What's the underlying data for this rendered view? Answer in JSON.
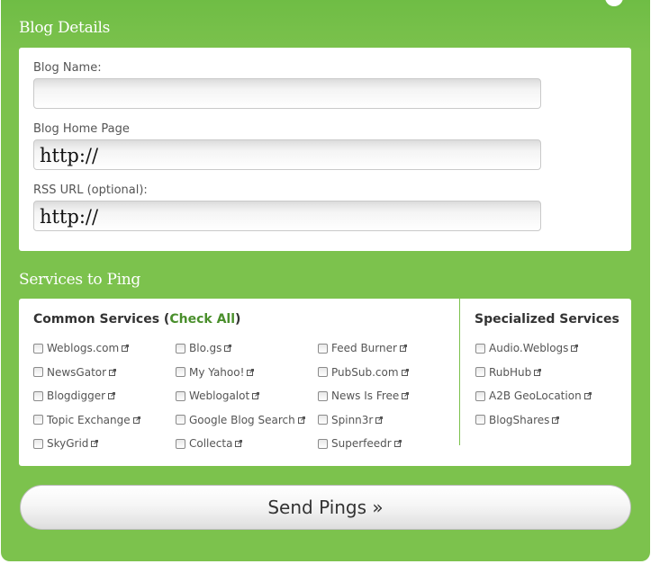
{
  "blog_details": {
    "title": "Blog Details",
    "name_label": "Blog Name:",
    "name_value": "",
    "home_label": "Blog Home Page",
    "home_value": "http://",
    "rss_label": "RSS URL (optional):",
    "rss_value": "http://"
  },
  "services": {
    "title": "Services to Ping",
    "common_title": "Common Services (",
    "check_all": "Check All",
    "common_title_close": ")",
    "specialized_title": "Specialized Services",
    "common": [
      "Weblogs.com",
      "NewsGator",
      "Blogdigger",
      "Topic Exchange",
      "SkyGrid",
      "Blo.gs",
      "My Yahoo!",
      "Weblogalot",
      "Google Blog Search",
      "Collecta",
      "Feed Burner",
      "PubSub.com",
      "News Is Free",
      "Spinn3r",
      "Superfeedr"
    ],
    "specialized": [
      "Audio.Weblogs",
      "RubHub",
      "A2B GeoLocation",
      "BlogShares"
    ]
  },
  "send_button": "Send Pings »",
  "colors": {
    "frame_green": "#7cc24d",
    "link_green": "#4a8f2c"
  },
  "icons": {
    "external": "external-link-icon"
  }
}
